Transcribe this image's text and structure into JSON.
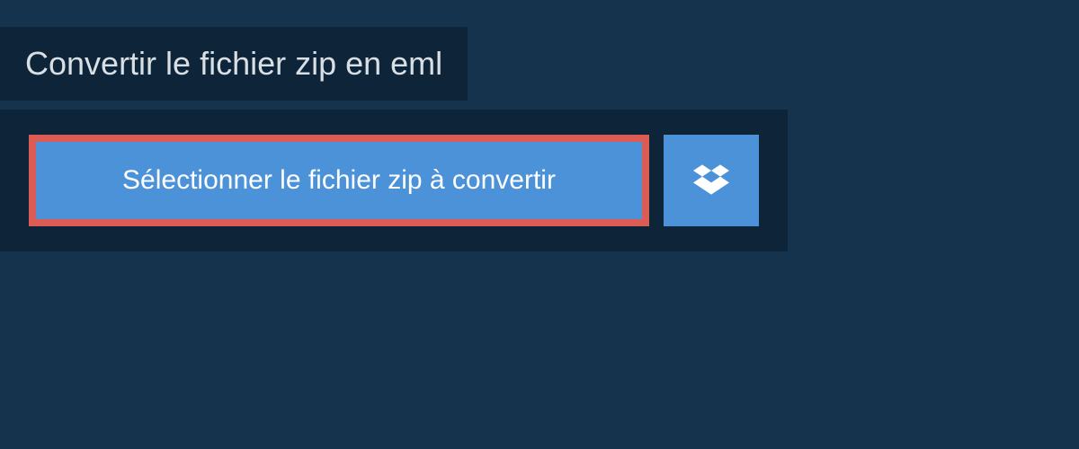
{
  "header": {
    "title": "Convertir le fichier zip en eml"
  },
  "actions": {
    "select_file_label": "Sélectionner le fichier zip à convertir"
  }
}
